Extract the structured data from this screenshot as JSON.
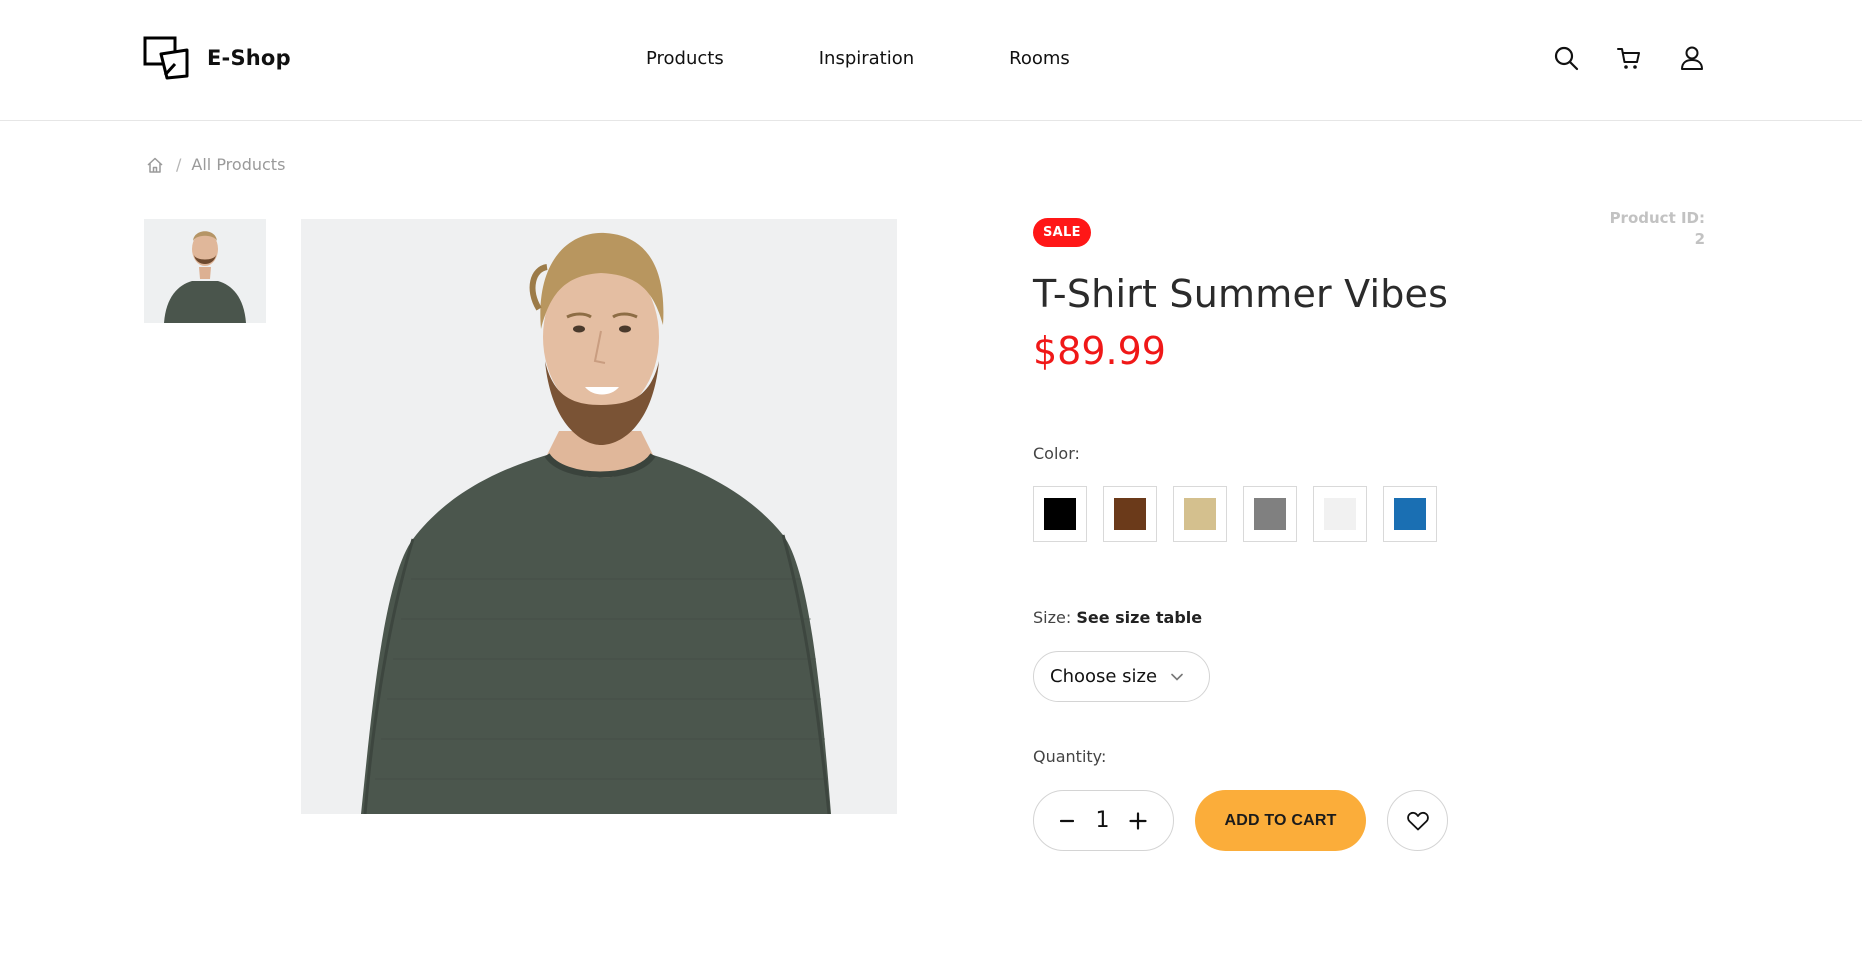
{
  "brand": {
    "name": "E-Shop",
    "logo_icon": "two-overlapping-squares-icon"
  },
  "nav": {
    "items": [
      {
        "label": "Products"
      },
      {
        "label": "Inspiration"
      },
      {
        "label": "Rooms"
      }
    ]
  },
  "header_icons": [
    "search-icon",
    "cart-icon",
    "user-icon"
  ],
  "breadcrumb": {
    "home_icon": "home-icon",
    "separator": "/",
    "current": "All Products"
  },
  "gallery": {
    "thumbnail_count": 1,
    "subject": "man-in-dark-green-knit-sweater"
  },
  "product": {
    "badge": "SALE",
    "id_label": "Product ID:",
    "id_value": "2",
    "title": "T-Shirt Summer Vibes",
    "price": "$89.99",
    "color_label": "Color:",
    "colors": [
      "#000000",
      "#6b3a1a",
      "#d4c08e",
      "#808080",
      "#f1f1f1",
      "#1a6fb3"
    ],
    "size_label": "Size:",
    "size_link": "See size table",
    "size_placeholder": "Choose size",
    "quantity_label": "Quantity:",
    "quantity": "1",
    "add_to_cart": "ADD TO CART"
  },
  "colors": {
    "accent": "#fbad3a",
    "sale": "#ff1717",
    "price": "#f01818"
  }
}
